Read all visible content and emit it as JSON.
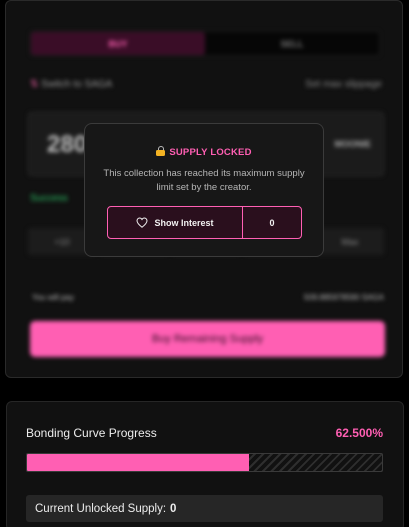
{
  "trade": {
    "tabs": [
      {
        "label": "BUY",
        "active": true
      },
      {
        "label": "SELL",
        "active": false
      }
    ],
    "switch_label": "Switch to SAGA",
    "slippage_label": "Set max slippage",
    "amount": "2800",
    "amount_unit": "MOONIE",
    "success_text": "Success",
    "quick_options": [
      "+10",
      "",
      "",
      "",
      "Max"
    ],
    "pay_label": "You will pay",
    "pay_value": "509.885978590 SAGA",
    "buy_button": "Buy Remaining Supply"
  },
  "modal": {
    "title": "SUPPLY LOCKED",
    "message": "This collection has reached its maximum supply limit set by the creator.",
    "interest_label": "Show Interest",
    "interest_count": "0",
    "icons": {
      "title": "lock-icon",
      "interest": "heart-icon"
    }
  },
  "curve": {
    "label": "Bonding Curve Progress",
    "percent_text": "62.500%",
    "progress_fraction": 0.625,
    "unlocked_label": "Current Unlocked Supply:",
    "unlocked_value": "0"
  },
  "colors": {
    "accent": "#ff5fb3",
    "background": "#000000",
    "card": "#111111",
    "success": "#2bbf64"
  }
}
